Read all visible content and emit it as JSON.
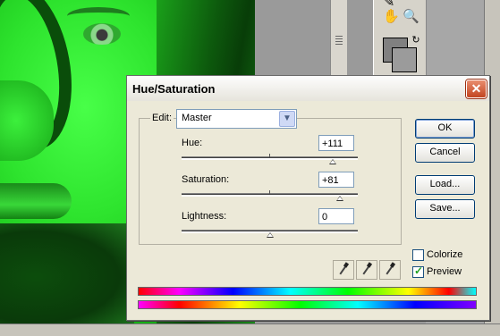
{
  "dialog": {
    "title": "Hue/Saturation",
    "edit_label": "Edit:",
    "edit_value": "Master",
    "sliders": [
      {
        "label": "Hue:",
        "value": "+111",
        "fraction": 0.86
      },
      {
        "label": "Saturation:",
        "value": "+81",
        "fraction": 0.9
      },
      {
        "label": "Lightness:",
        "value": "0",
        "fraction": 0.5
      }
    ],
    "buttons": {
      "ok": "OK",
      "cancel": "Cancel",
      "load": "Load...",
      "save": "Save..."
    },
    "checkboxes": {
      "colorize": {
        "label": "Colorize",
        "checked": false
      },
      "preview": {
        "label": "Preview",
        "checked": true
      }
    }
  },
  "icons": [
    "hand-tool-icon",
    "zoom-tool-icon",
    "eyedropper-icon",
    "eyedropper-plus-icon",
    "eyedropper-minus-icon",
    "swap-colors-icon",
    "close-icon",
    "chevron-down-icon"
  ],
  "colors": {
    "image_tint": "#2ee42e",
    "dialog_bg": "#ece9d8",
    "close_button": "#c24521"
  }
}
